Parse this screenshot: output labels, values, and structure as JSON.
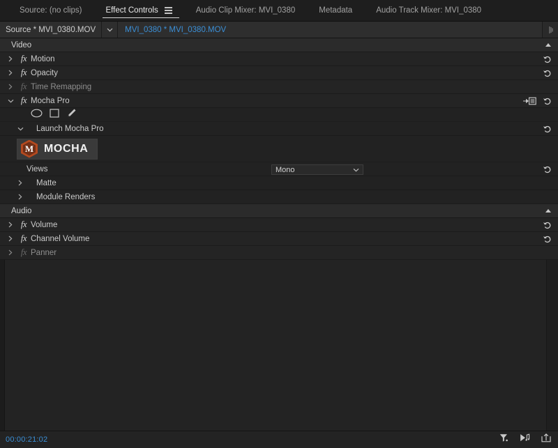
{
  "panel": {
    "tabs": [
      {
        "label": "Source: (no clips)",
        "active": false
      },
      {
        "label": "Effect Controls",
        "active": true,
        "menu_icon": "hamburger-menu-icon"
      },
      {
        "label": "Audio Clip Mixer: MVI_0380",
        "active": false
      },
      {
        "label": "Metadata",
        "active": false
      },
      {
        "label": "Audio Track Mixer: MVI_0380",
        "active": false
      }
    ]
  },
  "clipbar": {
    "source_label": "Source * MVI_0380.MOV",
    "caret_icon": "chevron-down-icon",
    "target_label": "MVI_0380 * MVI_0380.MOV",
    "handle_icon": "panel-resize-handle-icon"
  },
  "effects": {
    "video": {
      "group_label": "Video",
      "collapse_icon": "triangle-up-icon",
      "items": [
        {
          "name": "Motion",
          "fx": "fx",
          "fx_dim": false,
          "twisty": "chevron-right-icon",
          "reset": true,
          "label_dim": false
        },
        {
          "name": "Opacity",
          "fx": "fx",
          "fx_dim": false,
          "twisty": "chevron-right-icon",
          "reset": true,
          "label_dim": false
        },
        {
          "name": "Time Remapping",
          "fx": "fx",
          "fx_dim": true,
          "twisty": "chevron-right-icon",
          "reset": false,
          "label_dim": true
        },
        {
          "name": "Mocha Pro",
          "fx": "fx",
          "fx_dim": false,
          "twisty": "chevron-down-icon",
          "reset": true,
          "label_dim": false,
          "to_list_icon": "send-to-list-icon"
        }
      ]
    },
    "mocha": {
      "tools": [
        {
          "name": "ellipse-mask-tool",
          "icon": "ellipse-icon"
        },
        {
          "name": "rectangle-mask-tool",
          "icon": "rectangle-icon"
        },
        {
          "name": "pen-mask-tool",
          "icon": "pen-icon"
        }
      ],
      "launch_row": {
        "label": "Launch Mocha Pro",
        "twisty": "chevron-down-icon",
        "reset": true
      },
      "logo_button": {
        "badge_letter": "M",
        "wordmark": "MOCHA",
        "badge_color": "#b4491f"
      },
      "views_row": {
        "label": "Views",
        "value": "Mono",
        "dropdown_icon": "chevron-down-icon",
        "reset": true
      },
      "sub_rows": [
        {
          "label": "Matte",
          "twisty": "chevron-right-icon"
        },
        {
          "label": "Module Renders",
          "twisty": "chevron-right-icon"
        }
      ]
    },
    "audio": {
      "group_label": "Audio",
      "collapse_icon": "triangle-up-icon",
      "items": [
        {
          "name": "Volume",
          "fx": "fx",
          "fx_dim": false,
          "twisty": "chevron-right-icon",
          "reset": true,
          "label_dim": false
        },
        {
          "name": "Channel Volume",
          "fx": "fx",
          "fx_dim": false,
          "twisty": "chevron-right-icon",
          "reset": true,
          "label_dim": false
        },
        {
          "name": "Panner",
          "fx": "fx",
          "fx_dim": true,
          "twisty": "chevron-right-icon",
          "reset": false,
          "label_dim": true
        }
      ]
    }
  },
  "bottom": {
    "timecode": "00:00:21:02",
    "icons": [
      {
        "name": "filter-icon"
      },
      {
        "name": "play-audio-icon"
      },
      {
        "name": "export-icon"
      }
    ]
  },
  "colors": {
    "accent_blue": "#3b8fd6",
    "mocha_orange": "#b4491f",
    "panel_bg": "#232323"
  }
}
